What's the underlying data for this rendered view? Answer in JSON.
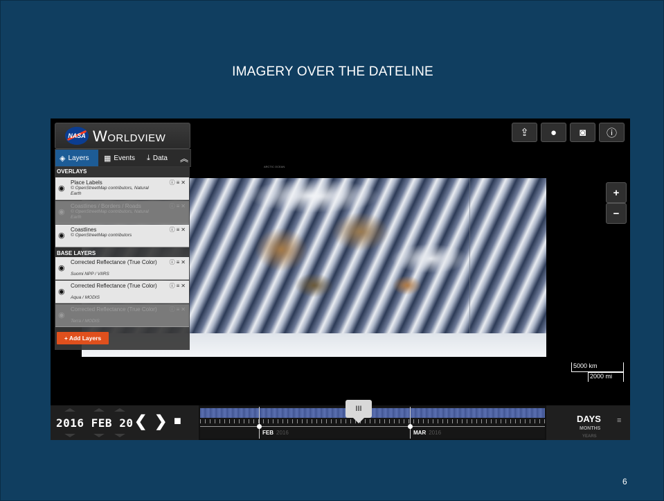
{
  "slide": {
    "title": "IMAGERY OVER THE DATELINE",
    "page_number": "6",
    "background_color": "#103e60"
  },
  "app": {
    "logo": {
      "badge": "NASA",
      "text": "Worldview"
    },
    "tabs": [
      {
        "label": "Layers",
        "icon": "layers-icon"
      },
      {
        "label": "Events",
        "icon": "calendar-icon"
      },
      {
        "label": "Data",
        "icon": "download-icon"
      }
    ],
    "sections": {
      "overlays": "OVERLAYS",
      "base_layers": "BASE LAYERS"
    },
    "overlays": [
      {
        "name": "Place Labels",
        "source": "© OpenStreetMap contributors, Natural Earth",
        "visible": true
      },
      {
        "name": "Coastlines / Borders / Roads",
        "source": "© OpenStreetMap contributors, Natural Earth",
        "visible": false
      },
      {
        "name": "Coastlines",
        "source": "© OpenStreetMap contributors",
        "visible": true
      }
    ],
    "base_layers": [
      {
        "name": "Corrected Reflectance (True Color)",
        "source": "Suomi NPP / VIIRS",
        "visible": true
      },
      {
        "name": "Corrected Reflectance (True Color)",
        "source": "Aqua / MODIS",
        "visible": true
      },
      {
        "name": "Corrected Reflectance (True Color)",
        "source": "Terra / MODIS",
        "visible": false
      }
    ],
    "add_layers_label": "+ Add Layers",
    "toolbar_icons": [
      "share-icon",
      "globe-icon",
      "camera-icon",
      "info-icon"
    ],
    "zoom": {
      "in": "+",
      "out": "−"
    },
    "map_label": "ARCTIC OCEAN",
    "scale": {
      "km": "5000 km",
      "mi": "2000 mi"
    },
    "timeline": {
      "date": "2016 FEB 20",
      "months": [
        {
          "label": "FEB",
          "year": "2016"
        },
        {
          "label": "MAR",
          "year": "2016"
        }
      ],
      "handle_label": "III",
      "zoom_levels": {
        "active": "DAYS",
        "next": "MONTHS",
        "last": "YEARS"
      }
    },
    "colors": {
      "accent_tab": "#1d5c96",
      "add_button": "#e0501d",
      "timeline_band": "#4a5f9d"
    }
  }
}
